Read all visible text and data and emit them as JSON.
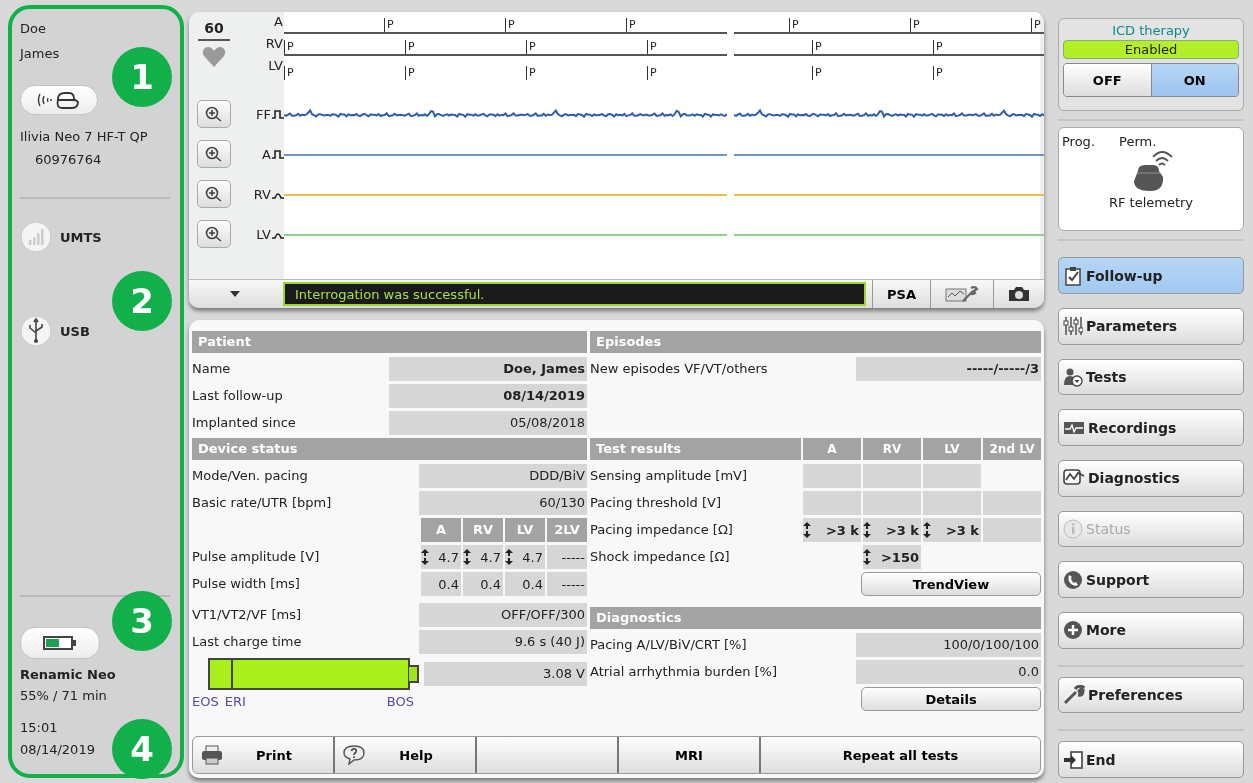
{
  "sidebar": {
    "last_name": "Doe",
    "first_name": "James",
    "implant": "Ilivia Neo 7 HF-T QP",
    "serial": "60976764",
    "connections": [
      {
        "label": "UMTS"
      },
      {
        "label": "USB"
      }
    ],
    "programmer": {
      "name": "Renamic Neo",
      "charge": "55% / 71 min"
    },
    "time": "15:01",
    "date": "08/14/2019"
  },
  "callouts": [
    "1",
    "2",
    "3",
    "4"
  ],
  "ecg": {
    "rate": "60",
    "marker_rows": [
      {
        "label": "A",
        "halves": [
          [
            "P",
            "P",
            "P"
          ],
          [
            "P",
            "P",
            "P"
          ]
        ]
      },
      {
        "label": "RV",
        "halves": [
          [
            "P",
            "P",
            "P",
            "P"
          ],
          [
            "P",
            "P"
          ]
        ]
      },
      {
        "label": "LV",
        "halves": [
          [
            "P",
            "P",
            "P",
            "P"
          ],
          [
            "P",
            "P"
          ]
        ]
      }
    ],
    "channels": [
      {
        "label": "FF",
        "kind": "noisy",
        "color": "#2f5fa8"
      },
      {
        "label": "A",
        "kind": "flat",
        "color": "#6e95c8"
      },
      {
        "label": "RV",
        "kind": "flat",
        "color": "#f0bc4a"
      },
      {
        "label": "LV",
        "kind": "flat",
        "color": "#8cd48c"
      }
    ],
    "message": "Interrogation was successful.",
    "psa": "PSA"
  },
  "patient": {
    "title": "Patient",
    "rows": [
      {
        "label": "Name",
        "value": "Doe, James",
        "bold": true
      },
      {
        "label": "Last follow-up",
        "value": "08/14/2019",
        "bold": true
      },
      {
        "label": "Implanted since",
        "value": "05/08/2018",
        "bold": false
      }
    ]
  },
  "episodes": {
    "title": "Episodes",
    "rows": [
      {
        "label": "New episodes VF/VT/others",
        "value": "-----/-----/3",
        "bold": true
      }
    ]
  },
  "device_status": {
    "title": "Device status",
    "rows_top": [
      {
        "label": "Mode/Ven. pacing",
        "value": "DDD/BiV"
      },
      {
        "label": "Basic rate/UTR [bpm]",
        "value": "60/130"
      }
    ],
    "columns": [
      "A",
      "RV",
      "LV",
      "2LV"
    ],
    "grid_rows": [
      {
        "label": "Pulse amplitude [V]",
        "cells": [
          {
            "text": "4.7",
            "adjustable": true
          },
          {
            "text": "4.7",
            "adjustable": true
          },
          {
            "text": "4.7",
            "adjustable": true
          },
          {
            "text": "-----",
            "adjustable": false
          }
        ]
      },
      {
        "label": "Pulse width [ms]",
        "cells": [
          {
            "text": "0.4",
            "adjustable": false
          },
          {
            "text": "0.4",
            "adjustable": false
          },
          {
            "text": "0.4",
            "adjustable": false
          },
          {
            "text": "-----",
            "adjustable": false
          }
        ]
      }
    ],
    "rows_bottom": [
      {
        "label": "VT1/VT2/VF [ms]",
        "value": "OFF/OFF/300"
      },
      {
        "label": "Last charge time",
        "value": "9.6 s (40 J)"
      }
    ],
    "battery": {
      "level": 1,
      "voltage": "3.08 V",
      "scale_left": [
        "EOS",
        "ERI"
      ],
      "scale_right": "BOS"
    }
  },
  "test_results": {
    "title": "Test results",
    "columns": [
      "A",
      "RV",
      "LV",
      "2nd LV"
    ],
    "rows": [
      {
        "label": "Sensing amplitude [mV]",
        "cells": [
          {
            "kind": "blank"
          },
          {
            "kind": "blank"
          },
          {
            "kind": "blank"
          },
          {
            "kind": "none"
          }
        ]
      },
      {
        "label": "Pacing threshold [V]",
        "cells": [
          {
            "kind": "blank"
          },
          {
            "kind": "blank"
          },
          {
            "kind": "blank"
          },
          {
            "kind": "blank"
          }
        ]
      },
      {
        "label": "Pacing impedance [Ω]",
        "cells": [
          {
            "kind": "value",
            "text": ">3 k",
            "adjustable": true
          },
          {
            "kind": "value",
            "text": ">3 k",
            "adjustable": true
          },
          {
            "kind": "value",
            "text": ">3 k",
            "adjustable": true
          },
          {
            "kind": "blank"
          }
        ]
      },
      {
        "label": "Shock impedance [Ω]",
        "cells": [
          {
            "kind": "none"
          },
          {
            "kind": "value",
            "text": ">150",
            "adjustable": true
          },
          {
            "kind": "none"
          },
          {
            "kind": "none"
          }
        ]
      }
    ],
    "button": "TrendView"
  },
  "diagnostics": {
    "title": "Diagnostics",
    "rows": [
      {
        "label": "Pacing A/LV/BiV/CRT [%]",
        "value": "100/0/100/100"
      },
      {
        "label": "Atrial arrhythmia burden [%]",
        "value": "0.0"
      }
    ],
    "button": "Details"
  },
  "footer": [
    {
      "kind": "print",
      "label": "Print"
    },
    {
      "kind": "help",
      "label": "Help"
    },
    {
      "kind": "blank"
    },
    {
      "kind": "plain",
      "label": "MRI"
    },
    {
      "kind": "plain",
      "label": "Repeat all tests"
    }
  ],
  "therapy": {
    "title": "ICD therapy",
    "status": "Enabled",
    "options": [
      {
        "label": "OFF",
        "selected": false
      },
      {
        "label": "ON",
        "selected": true
      }
    ]
  },
  "telemetry": {
    "mode_left": "Prog.",
    "mode_right": "Perm.",
    "label": "RF telemetry"
  },
  "nav": [
    {
      "label": "Follow-up",
      "selected": true,
      "disabled": false,
      "separator_before": false
    },
    {
      "label": "Parameters",
      "selected": false,
      "disabled": false,
      "separator_before": false
    },
    {
      "label": "Tests",
      "selected": false,
      "disabled": false,
      "separator_before": false
    },
    {
      "label": "Recordings",
      "selected": false,
      "disabled": false,
      "separator_before": false
    },
    {
      "label": "Diagnostics",
      "selected": false,
      "disabled": false,
      "separator_before": false
    },
    {
      "label": "Status",
      "selected": false,
      "disabled": true,
      "separator_before": false
    },
    {
      "label": "Support",
      "selected": false,
      "disabled": false,
      "separator_before": false
    },
    {
      "label": "More",
      "selected": false,
      "disabled": false,
      "separator_before": false
    },
    {
      "label": "Preferences",
      "selected": false,
      "disabled": false,
      "separator_before": true
    },
    {
      "label": "End",
      "selected": false,
      "disabled": false,
      "separator_before": true
    }
  ]
}
